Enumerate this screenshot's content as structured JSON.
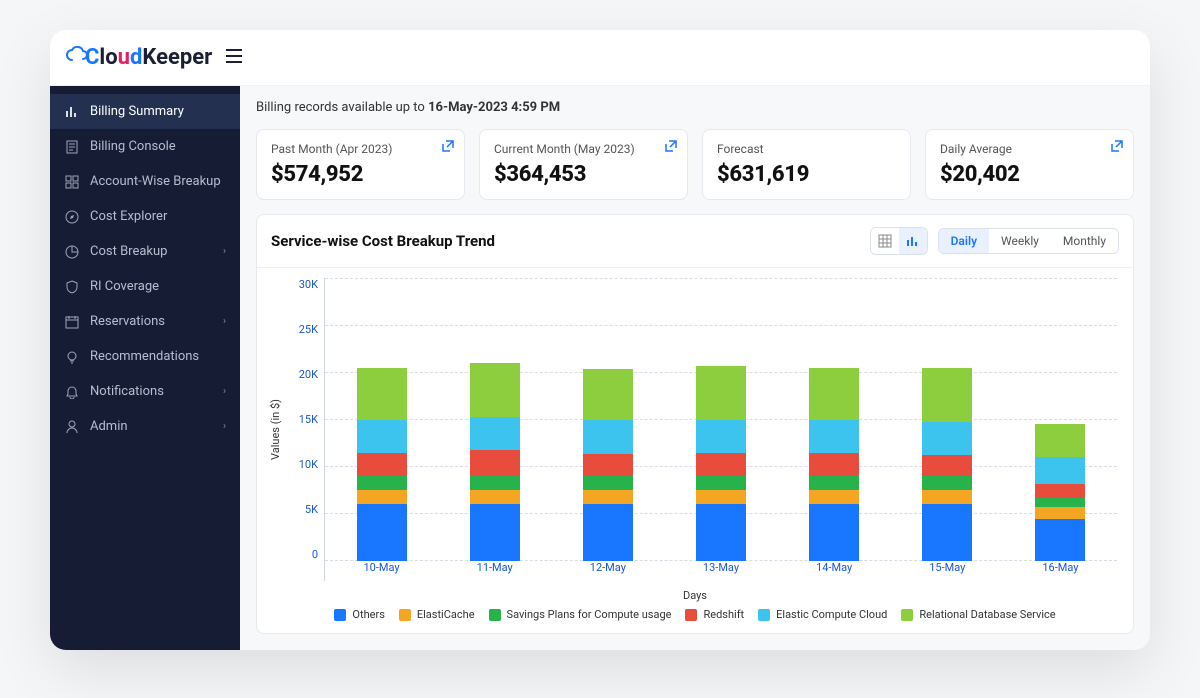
{
  "header": {
    "brand_parts": [
      "C",
      "lo",
      "u",
      "d",
      "Keeper"
    ]
  },
  "sidebar": {
    "items": [
      {
        "label": "Billing Summary",
        "icon": "bar-chart",
        "active": true
      },
      {
        "label": "Billing Console",
        "icon": "receipt"
      },
      {
        "label": "Account-Wise Breakup",
        "icon": "grid"
      },
      {
        "label": "Cost Explorer",
        "icon": "compass"
      },
      {
        "label": "Cost Breakup",
        "icon": "pie",
        "caret": true
      },
      {
        "label": "RI Coverage",
        "icon": "shield"
      },
      {
        "label": "Reservations",
        "icon": "calendar",
        "caret": true
      },
      {
        "label": "Recommendations",
        "icon": "light"
      },
      {
        "label": "Notifications",
        "icon": "bell",
        "caret": true
      },
      {
        "label": "Admin",
        "icon": "user",
        "caret": true
      }
    ]
  },
  "records_line": {
    "prefix": "Billing records available up to ",
    "bold": "16-May-2023 4:59 PM"
  },
  "cards": [
    {
      "label": "Past Month (Apr 2023)",
      "value": "$574,952",
      "popout": true
    },
    {
      "label": "Current Month (May 2023)",
      "value": "$364,453",
      "popout": true
    },
    {
      "label": "Forecast",
      "value": "$631,619",
      "popout": false
    },
    {
      "label": "Daily Average",
      "value": "$20,402",
      "popout": true
    }
  ],
  "panel": {
    "title": "Service-wise Cost Breakup Trend",
    "view_mode": "chart",
    "ranges": [
      "Daily",
      "Weekly",
      "Monthly"
    ],
    "active_range": "Daily"
  },
  "chart_data": {
    "type": "bar",
    "title": "Service-wise Cost Breakup Trend",
    "xlabel": "Days",
    "ylabel": "Values (in $)",
    "ylim": [
      0,
      30000
    ],
    "yticks": [
      "30K",
      "25K",
      "20K",
      "15K",
      "10K",
      "5K",
      "0"
    ],
    "categories": [
      "10-May",
      "11-May",
      "12-May",
      "13-May",
      "14-May",
      "15-May",
      "16-May"
    ],
    "series": [
      {
        "name": "Others",
        "color": "#1976ff",
        "values": [
          6000,
          6000,
          6000,
          6000,
          6000,
          6000,
          4500
        ]
      },
      {
        "name": "ElastiCache",
        "color": "#f4a623",
        "values": [
          1500,
          1500,
          1500,
          1500,
          1500,
          1500,
          1200
        ]
      },
      {
        "name": "Savings Plans for Compute usage",
        "color": "#28b24c",
        "values": [
          1500,
          1500,
          1500,
          1500,
          1500,
          1500,
          1000
        ]
      },
      {
        "name": "Redshift",
        "color": "#e74c3c",
        "values": [
          2500,
          2800,
          2400,
          2500,
          2500,
          2200,
          1500
        ]
      },
      {
        "name": "Elastic Compute Cloud",
        "color": "#3cc4ef",
        "values": [
          3500,
          3500,
          3500,
          3500,
          3500,
          3500,
          2800
        ]
      },
      {
        "name": "Relational Database Service",
        "color": "#8cce3d",
        "values": [
          5500,
          5700,
          5500,
          5700,
          5500,
          5800,
          3500
        ]
      }
    ]
  }
}
